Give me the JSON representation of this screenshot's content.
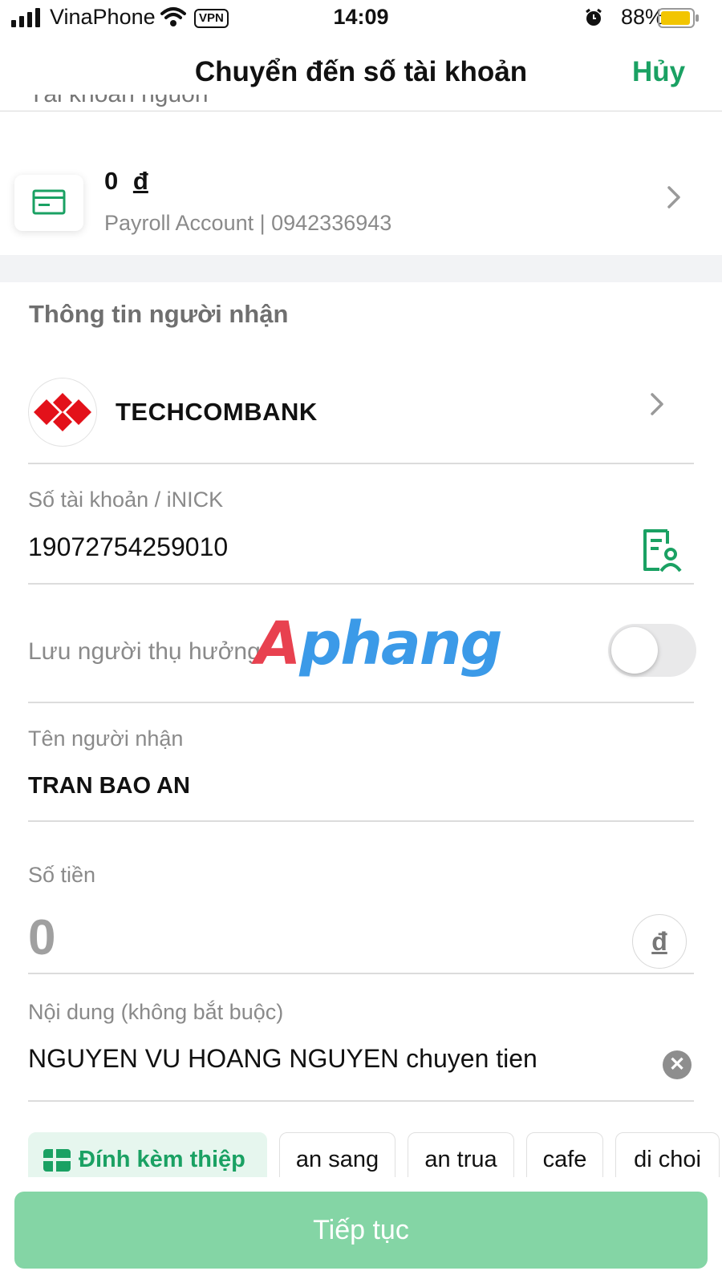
{
  "status_bar": {
    "carrier": "VinaPhone",
    "vpn": "VPN",
    "time": "14:09",
    "battery": "88%"
  },
  "header": {
    "title": "Chuyển đến số tài khoản",
    "cancel": "Hủy"
  },
  "source": {
    "section_label": "Tài khoản nguồn",
    "amount": "0",
    "currency": "đ",
    "account_desc": "Payroll Account | 0942336943"
  },
  "recipient": {
    "section_title": "Thông tin người nhận",
    "bank_name": "TECHCOMBANK",
    "account_label": "Số tài khoản / iNICK",
    "account_number": "19072754259010",
    "save_label": "Lưu người thụ hưởng",
    "save_enabled": false,
    "name_label": "Tên người nhận",
    "name_value": "TRAN BAO AN"
  },
  "watermark": {
    "first": "A",
    "rest": "phang"
  },
  "amount": {
    "label": "Số tiền",
    "placeholder": "0",
    "currency_symbol": "đ"
  },
  "note": {
    "label": "Nội dung (không bắt buộc)",
    "value": "NGUYEN VU HOANG NGUYEN chuyen tien"
  },
  "chips": {
    "attach_card": "Đính kèm thiệp",
    "items": [
      "an sang",
      "an trua",
      "cafe",
      "di choi"
    ]
  },
  "footer": {
    "continue": "Tiếp tục"
  },
  "colors": {
    "brand_green": "#1aa163",
    "button_disabled": "#84d5a5",
    "techcombank_red": "#e3111a"
  }
}
